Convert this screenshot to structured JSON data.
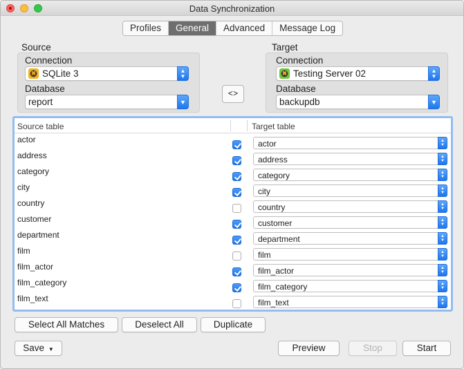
{
  "window": {
    "title": "Data Synchronization"
  },
  "tabs": [
    {
      "label": "Profiles",
      "active": false
    },
    {
      "label": "General",
      "active": true
    },
    {
      "label": "Advanced",
      "active": false
    },
    {
      "label": "Message Log",
      "active": false
    }
  ],
  "source": {
    "heading": "Source",
    "connection_label": "Connection",
    "connection_value": "SQLite 3",
    "database_label": "Database",
    "database_value": "report"
  },
  "target": {
    "heading": "Target",
    "connection_label": "Connection",
    "connection_value": "Testing Server 02",
    "database_label": "Database",
    "database_value": "backupdb"
  },
  "swap_button": "<>",
  "table": {
    "col_source": "Source table",
    "col_target": "Target table",
    "rows": [
      {
        "source": "actor",
        "checked": true,
        "target": "actor"
      },
      {
        "source": "address",
        "checked": true,
        "target": "address"
      },
      {
        "source": "category",
        "checked": true,
        "target": "category"
      },
      {
        "source": "city",
        "checked": true,
        "target": "city"
      },
      {
        "source": "country",
        "checked": false,
        "target": "country"
      },
      {
        "source": "customer",
        "checked": true,
        "target": "customer"
      },
      {
        "source": "department",
        "checked": true,
        "target": "department"
      },
      {
        "source": "film",
        "checked": false,
        "target": "film"
      },
      {
        "source": "film_actor",
        "checked": true,
        "target": "film_actor"
      },
      {
        "source": "film_category",
        "checked": true,
        "target": "film_category"
      },
      {
        "source": "film_text",
        "checked": false,
        "target": "film_text"
      }
    ]
  },
  "buttons": {
    "select_all": "Select All Matches",
    "deselect_all": "Deselect All",
    "duplicate": "Duplicate",
    "save": "Save",
    "preview": "Preview",
    "stop": "Stop",
    "start": "Start"
  },
  "colors": {
    "accent": "#1e77ee",
    "table_focus": "#93bcf0"
  }
}
